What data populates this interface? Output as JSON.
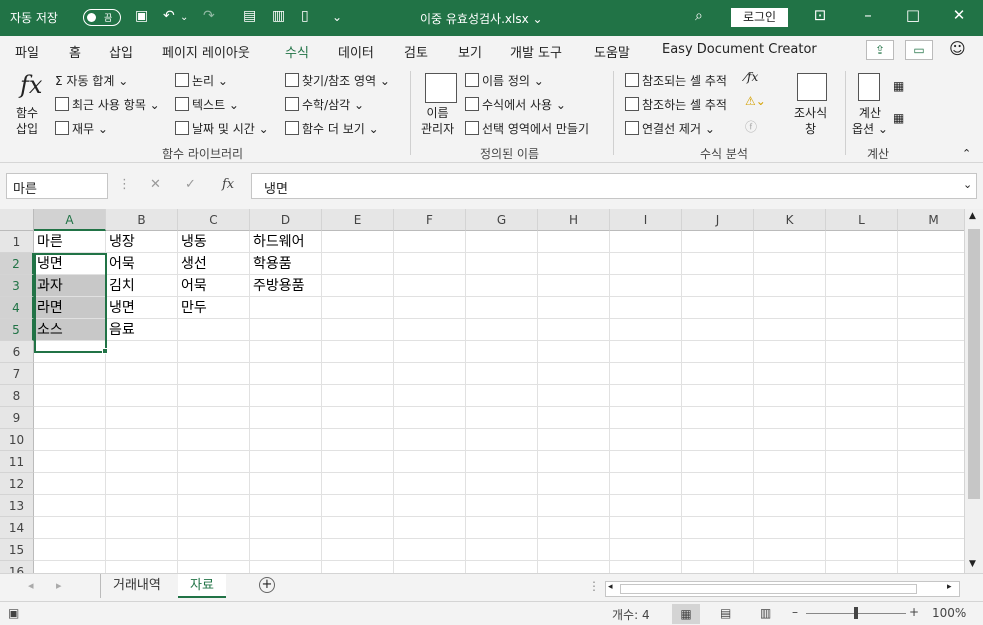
{
  "titlebar": {
    "autosave_label": "자동 저장",
    "autosave_state": "끔",
    "title": "이중 유효성검사.xlsx ⌄",
    "login": "로그인"
  },
  "tabs": [
    "파일",
    "홈",
    "삽입",
    "페이지 레이아웃",
    "수식",
    "데이터",
    "검토",
    "보기",
    "개발 도구",
    "도움말",
    "Easy Document Creator"
  ],
  "active_tab": "수식",
  "ribbon": {
    "insert_function": "함수\n삽입",
    "function_library": {
      "autosum": "자동 합계 ⌄",
      "recent": "최근 사용 항목 ⌄",
      "financial": "재무 ⌄",
      "logical": "논리 ⌄",
      "text": "텍스트 ⌄",
      "datetime": "날짜 및 시간 ⌄",
      "lookup": "찾기/참조 영역 ⌄",
      "math": "수학/삼각 ⌄",
      "more": "함수 더 보기 ⌄",
      "group_label": "함수 라이브러리"
    },
    "defined_names": {
      "name_manager": "이름\n관리자",
      "define_name": "이름 정의 ⌄",
      "use_in_formula": "수식에서 사용 ⌄",
      "create_from_selection": "선택 영역에서 만들기",
      "group_label": "정의된 이름"
    },
    "formula_auditing": {
      "trace_precedents": "참조되는 셀 추적",
      "trace_dependents": "참조하는 셀 추적",
      "remove_arrows": "연결선 제거 ⌄",
      "watch": "조사식\n창",
      "group_label": "수식 분석"
    },
    "calculation": {
      "options": "계산\n옵션 ⌄",
      "group_label": "계산"
    }
  },
  "formula_bar": {
    "name_box": "마른",
    "content": "냉면"
  },
  "columns": [
    "A",
    "B",
    "C",
    "D",
    "E",
    "F",
    "G",
    "H",
    "I",
    "J",
    "K",
    "L",
    "M"
  ],
  "rows": [
    "1",
    "2",
    "3",
    "4",
    "5",
    "6",
    "7",
    "8",
    "9",
    "10",
    "11",
    "12",
    "13",
    "14",
    "15",
    "16"
  ],
  "cells": [
    [
      "마른",
      "냉장",
      "냉동",
      "하드웨어"
    ],
    [
      "냉면",
      "어묵",
      "생선",
      "학용품"
    ],
    [
      "과자",
      "김치",
      "어묵",
      "주방용품"
    ],
    [
      "라면",
      "냉면",
      "만두",
      ""
    ],
    [
      "소스",
      "음료",
      "",
      ""
    ]
  ],
  "sheets": [
    "거래내역",
    "자료"
  ],
  "active_sheet": "자료",
  "status": {
    "count": "개수: 4",
    "zoom": "100%"
  }
}
